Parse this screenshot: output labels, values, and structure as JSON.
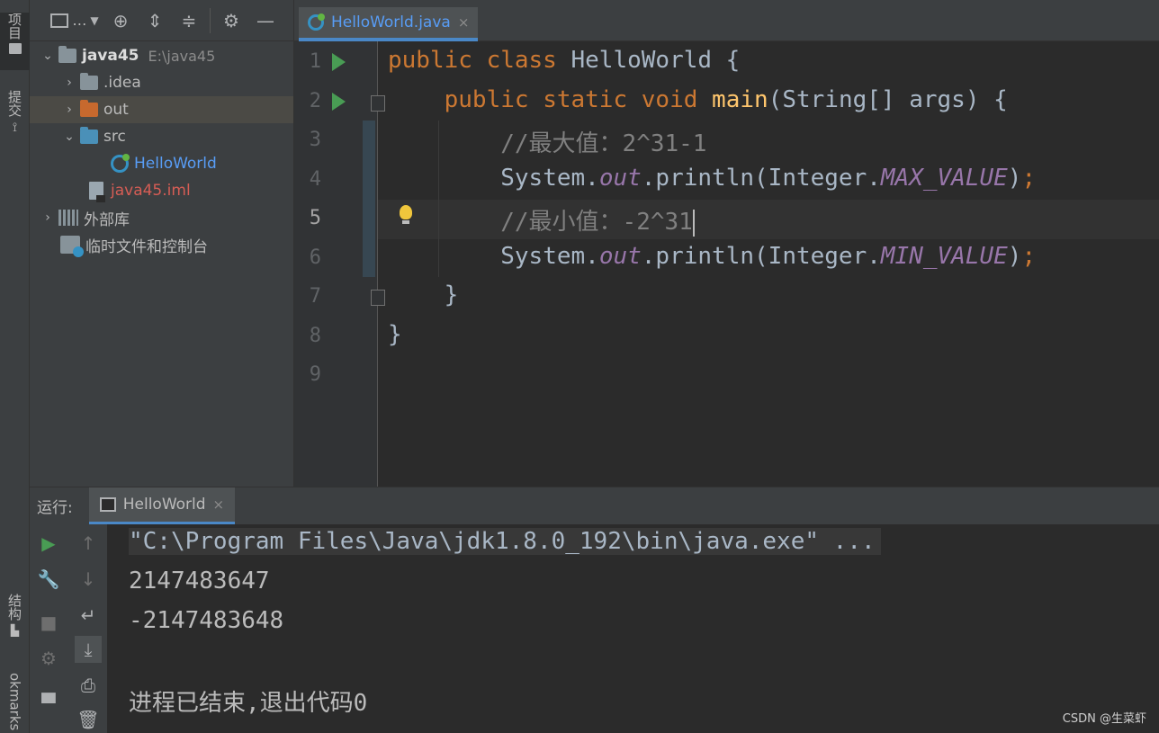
{
  "left_strip": {
    "project_tab": "项目",
    "commit_tab": "提交",
    "structure_tab": "结构",
    "bookmarks_tab": "okmarks"
  },
  "project_toolbar": {
    "dropdown_label": "…"
  },
  "tree": {
    "root_name": "java45",
    "root_path": "E:\\java45",
    "idea": ".idea",
    "out": "out",
    "src": "src",
    "hello_class": "HelloWorld",
    "iml": "java45.iml",
    "external_libs": "外部库",
    "scratches": "临时文件和控制台"
  },
  "editor_tab": {
    "title": "HelloWorld.java",
    "close": "×"
  },
  "editor": {
    "line_numbers": [
      "1",
      "2",
      "3",
      "4",
      "5",
      "6",
      "7",
      "8",
      "9"
    ],
    "code": {
      "l1_kw": "public class ",
      "l1_rest": "HelloWorld {",
      "l2_kw": "public static void ",
      "l2_fn": "main",
      "l2_rest": "(String[] args) {",
      "l3_comment": "//最大值：2^31-1",
      "l4_a": "System.",
      "l4_out": "out",
      "l4_b": ".println(Integer.",
      "l4_const": "MAX_VALUE",
      "l4_c": ")",
      "l4_semi": ";",
      "l5_comment": "//最小值：-2^31",
      "l6_a": "System.",
      "l6_out": "out",
      "l6_b": ".println(Integer.",
      "l6_const": "MIN_VALUE",
      "l6_c": ")",
      "l6_semi": ";",
      "l7": "}",
      "l8": "}"
    }
  },
  "run_panel": {
    "label": "运行:",
    "tab_title": "HelloWorld",
    "tab_close": "×",
    "console": {
      "command": "\"C:\\Program Files\\Java\\jdk1.8.0_192\\bin\\java.exe\" ...",
      "out1": "2147483647",
      "out2": "-2147483648",
      "exit": "进程已结束,退出代码0"
    }
  },
  "watermark": "CSDN @生菜虾",
  "colors": {
    "keyword": "#cc7832",
    "function": "#ffc66d",
    "static_field": "#9876aa",
    "comment": "#808080",
    "run_green": "#499c54",
    "accent_blue": "#4a88c7"
  }
}
